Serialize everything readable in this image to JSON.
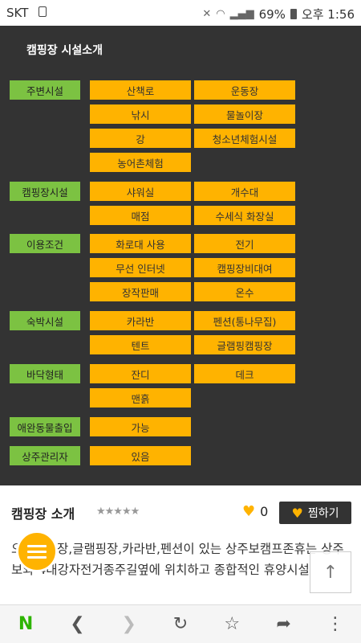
{
  "status_bar": {
    "carrier": "SKT",
    "battery": "69%",
    "time": "오후 1:56"
  },
  "panel": {
    "title": "캠핑장 시설소개",
    "categories": [
      {
        "label": "주변시설",
        "items": [
          "산책로",
          "운동장",
          "낚시",
          "물놀이장",
          "강",
          "청소년체험시설",
          "농어촌체험"
        ]
      },
      {
        "label": "캠핑장시설",
        "items": [
          "샤워실",
          "개수대",
          "매점",
          "수세식 화장실"
        ]
      },
      {
        "label": "이용조건",
        "items": [
          "화로대 사용",
          "전기",
          "무선 인터넷",
          "캠핑장비대여",
          "장작판매",
          "온수"
        ]
      },
      {
        "label": "숙박시설",
        "items": [
          "카라반",
          "펜션(통나무집)",
          "텐트",
          "글램핑캠핑장"
        ]
      },
      {
        "label": "바닥형태",
        "items": [
          "잔디",
          "데크",
          "맨흙"
        ]
      },
      {
        "label": "애완동물출입",
        "items": [
          "가능"
        ]
      },
      {
        "label": "상주관리자",
        "items": [
          "있음"
        ]
      }
    ]
  },
  "info": {
    "title": "캠핑장 소개",
    "stars": "★★★★★",
    "like_count": "0",
    "zzim_label": "찜하기",
    "description": "오토캠핑장,글램핑장,카라반,펜션이 있는 상주보캠프존휴는 상주보와 4대강자전거종주길옆에 위치하고 종합적인 휴양시설"
  },
  "nav": {
    "logo": "N"
  }
}
